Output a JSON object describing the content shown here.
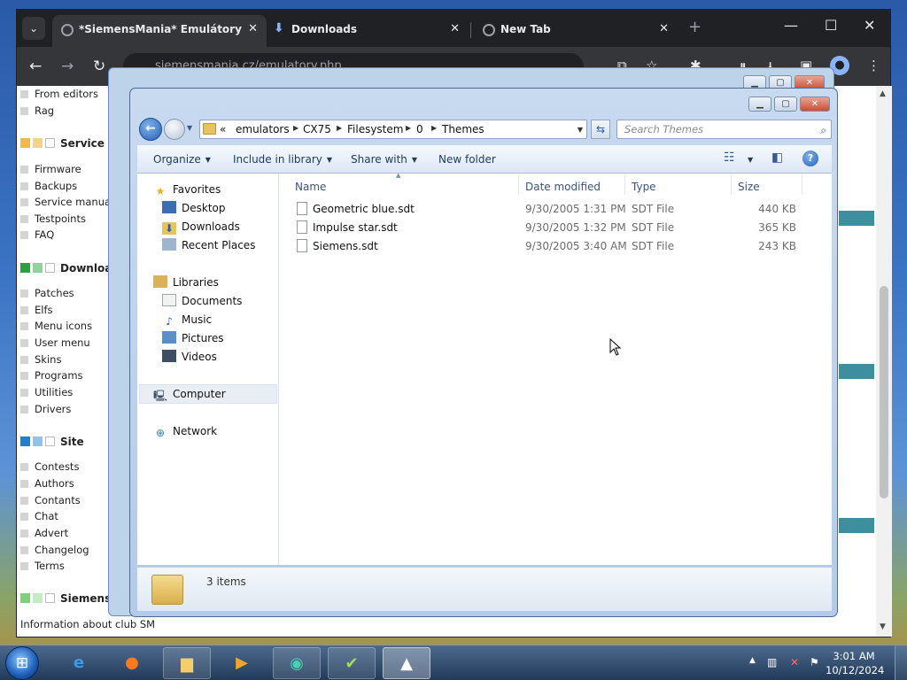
{
  "browser": {
    "tabs": [
      {
        "title": "*SiemensMania* Emulátory",
        "active": true
      },
      {
        "title": "Downloads",
        "active": false
      },
      {
        "title": "New Tab",
        "active": false
      }
    ],
    "url": "siemensmania.cz/emulatory.php"
  },
  "sidenav": {
    "items_top": [
      "From editors",
      "Rag"
    ],
    "service": {
      "heading": "Service",
      "color": "#f0b94a",
      "items": [
        "Firmware",
        "Backups",
        "Service manual",
        "Testpoints",
        "FAQ"
      ]
    },
    "downloads": {
      "heading": "Downloads",
      "color": "#2aa043",
      "items": [
        "Patches",
        "Elfs",
        "Menu icons",
        "User menu",
        "Skins",
        "Programs",
        "Utilities",
        "Drivers"
      ]
    },
    "site": {
      "heading": "Site",
      "color": "#1f7fd0",
      "items": [
        "Contests",
        "Authors",
        "Contants",
        "Chat",
        "Advert",
        "Changelog",
        "Terms"
      ]
    },
    "club": {
      "heading": "SiemensMania",
      "color": "#7ed07a",
      "items": [
        "Information about club SM"
      ]
    }
  },
  "explorer": {
    "breadcrumb": [
      "emulators",
      "CX75",
      "Filesystem",
      "0",
      "Themes"
    ],
    "search_placeholder": "Search Themes",
    "commands": [
      "Organize",
      "Include in library",
      "Share with",
      "New folder"
    ],
    "nav": {
      "favorites": {
        "label": "Favorites",
        "items": [
          "Desktop",
          "Downloads",
          "Recent Places"
        ]
      },
      "libraries": {
        "label": "Libraries",
        "items": [
          "Documents",
          "Music",
          "Pictures",
          "Videos"
        ]
      },
      "computer": "Computer",
      "network": "Network"
    },
    "columns": [
      "Name",
      "Date modified",
      "Type",
      "Size"
    ],
    "files": [
      {
        "name": "Geometric blue.sdt",
        "date": "9/30/2005 1:31 PM",
        "type": "SDT File",
        "size": "440 KB"
      },
      {
        "name": "Impulse star.sdt",
        "date": "9/30/2005 1:32 PM",
        "type": "SDT File",
        "size": "365 KB"
      },
      {
        "name": "Siemens.sdt",
        "date": "9/30/2005 3:40 AM",
        "type": "SDT File",
        "size": "243 KB"
      }
    ],
    "status": "3 items"
  },
  "taskbar": {
    "apps": [
      "internet-explorer-icon",
      "firefox-icon",
      "file-explorer-icon",
      "media-player-icon",
      "emulator-icon",
      "checklist-icon",
      "mtk-icon"
    ],
    "time": "3:01 AM",
    "date": "10/12/2024"
  }
}
